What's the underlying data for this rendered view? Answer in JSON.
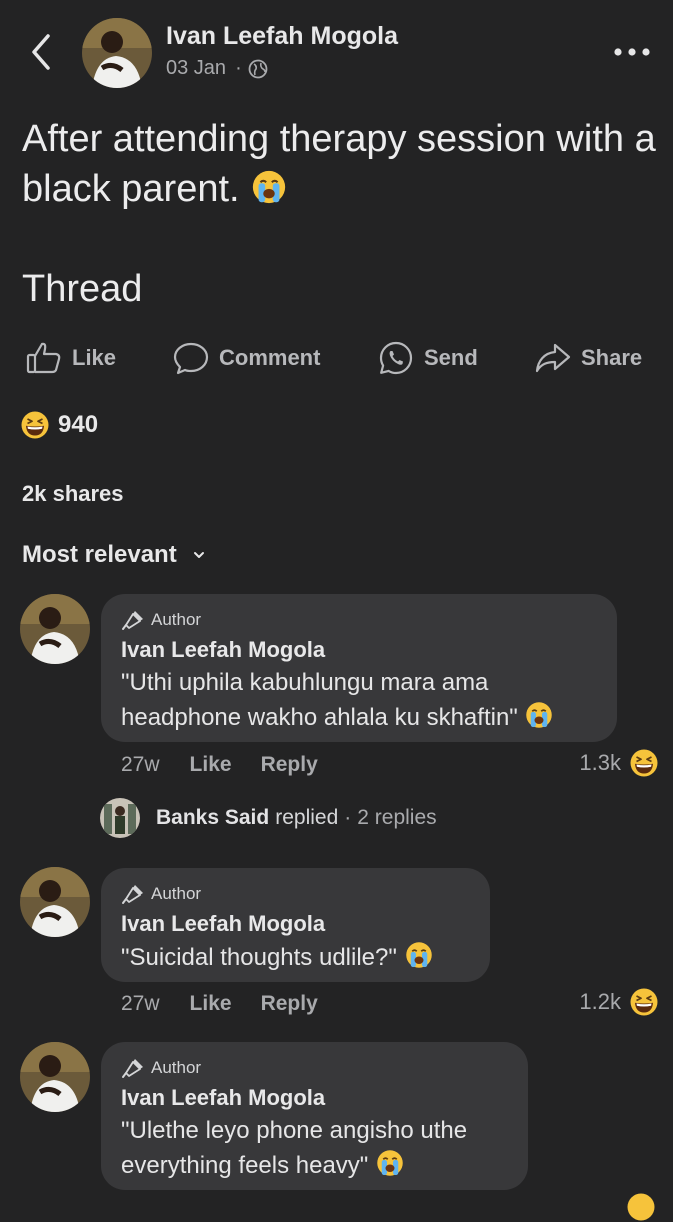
{
  "header": {
    "author": "Ivan Leefah Mogola",
    "date": "03 Jan",
    "separator": "·",
    "privacy_icon": "globe-icon"
  },
  "post": {
    "text": "After attending therapy session with a black parent.",
    "text_emoji": "loudly-crying-face",
    "thread_label": "Thread"
  },
  "actions": {
    "like": "Like",
    "comment": "Comment",
    "send": "Send",
    "share": "Share"
  },
  "reactions": {
    "emoji": "grinning-squinting-face",
    "count": "940"
  },
  "shares": "2k shares",
  "sort": {
    "label": "Most relevant",
    "icon": "chevron-down-icon"
  },
  "comments": [
    {
      "badge": "Author",
      "name": "Ivan Leefah Mogola",
      "text": "\"Uthi uphila kabuhlungu mara ama headphone wakho ahlala ku skhaftin\"",
      "time": "27w",
      "like": "Like",
      "reply": "Reply",
      "reaction_count": "1.3k"
    },
    {
      "badge": "Author",
      "name": "Ivan Leefah Mogola",
      "text": "\"Suicidal thoughts udlile?\"",
      "time": "27w",
      "like": "Like",
      "reply": "Reply",
      "reaction_count": "1.2k"
    },
    {
      "badge": "Author",
      "name": "Ivan Leefah Mogola",
      "text": "\"Ulethe leyo phone angisho uthe everything feels heavy\""
    }
  ],
  "reply_preview": {
    "name": "Banks Said",
    "verb": "replied",
    "separator": "·",
    "count": "2 replies"
  },
  "colors": {
    "background": "#232324",
    "bubble": "#38383a",
    "text_primary": "#e8e8e9",
    "text_secondary": "#a9aaad"
  }
}
